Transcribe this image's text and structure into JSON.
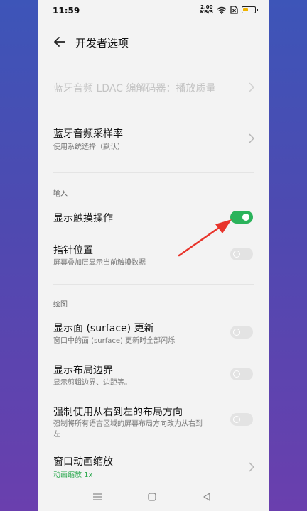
{
  "status": {
    "time": "11:59",
    "net_speed_value": "2.00",
    "net_speed_unit": "KB/S",
    "battery_level": 0.45,
    "battery_color": "#f0b400"
  },
  "header": {
    "back_icon": "arrow-left-icon",
    "title": "开发者选项"
  },
  "items": {
    "ldac": {
      "label": "蓝牙音频 LDAC 编解码器：播放质量"
    },
    "sample_rate": {
      "label": "蓝牙音频采样率",
      "sub": "使用系统选择（默认）"
    },
    "show_touches": {
      "label": "显示触摸操作",
      "on": true
    },
    "pointer_location": {
      "label": "指针位置",
      "sub": "屏幕叠加层显示当前触摸数据",
      "on": false
    },
    "surface_updates": {
      "label": "显示面 (surface) 更新",
      "sub": "窗口中的面 (surface) 更新时全部闪烁",
      "on": false
    },
    "layout_bounds": {
      "label": "显示布局边界",
      "sub": "显示剪辑边界、边距等。",
      "on": false
    },
    "rtl_layout": {
      "label": "强制使用从右到左的布局方向",
      "sub_line1": "强制将所有语言区域的屏幕布局方向改为从右到",
      "sub_line2": "左",
      "on": false
    },
    "window_anim": {
      "label": "窗口动画缩放",
      "sub": "动画缩放 1x"
    }
  },
  "sections": {
    "input": "输入",
    "drawing": "绘图"
  },
  "colors": {
    "accent_green": "#2bb35b",
    "annotation_red": "#e8342b"
  },
  "navbar": {
    "menu_icon": "menu-icon",
    "home_icon": "home-square-icon",
    "back_icon": "back-triangle-icon"
  }
}
